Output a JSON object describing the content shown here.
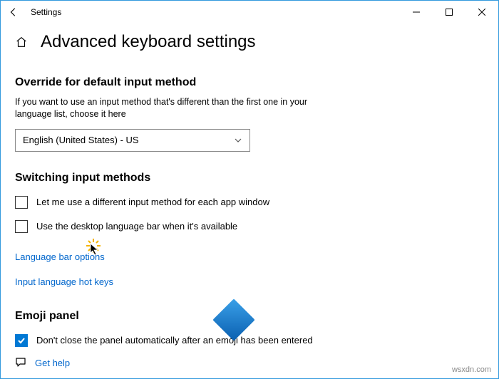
{
  "window": {
    "app_name": "Settings"
  },
  "header": {
    "page_title": "Advanced keyboard settings"
  },
  "override": {
    "heading": "Override for default input method",
    "desc": "If you want to use an input method that's different than the first one in your language list, choose it here",
    "combo_value": "English (United States) - US"
  },
  "switching": {
    "heading": "Switching input methods",
    "check_per_app": "Let me use a different input method for each app window",
    "check_langbar": "Use the desktop language bar when it's available",
    "link_langbar_options": "Language bar options",
    "link_hotkeys": "Input language hot keys"
  },
  "emoji": {
    "heading": "Emoji panel",
    "check_dont_close": "Don't close the panel automatically after an emoji has been entered"
  },
  "help": {
    "label": "Get help"
  },
  "watermark": "wsxdn.com"
}
